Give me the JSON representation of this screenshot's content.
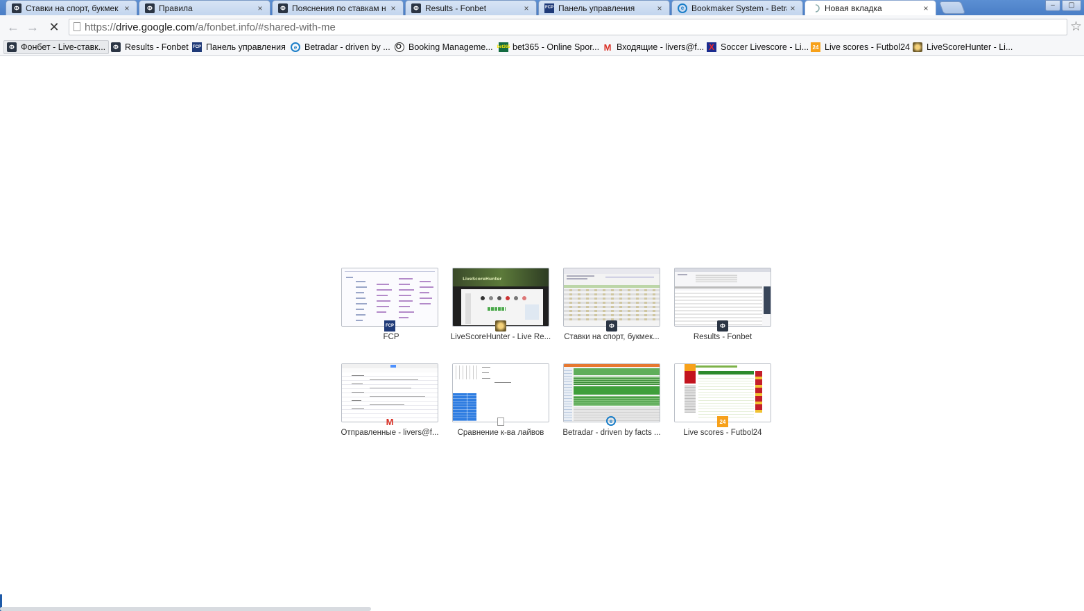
{
  "tabs": [
    {
      "title": "Ставки на спорт, букмек",
      "icon": "fonbet-icon",
      "active": false
    },
    {
      "title": "Правила",
      "icon": "fonbet-icon",
      "active": false
    },
    {
      "title": "Пояснения по ставкам н",
      "icon": "fonbet-icon",
      "active": false
    },
    {
      "title": "Results - Fonbet",
      "icon": "fonbet-icon",
      "active": false
    },
    {
      "title": "Панель управления",
      "icon": "fcp-icon",
      "active": false
    },
    {
      "title": "Bookmaker System - Betra",
      "icon": "betradar-icon",
      "active": false
    },
    {
      "title": "Новая вкладка",
      "icon": "loading-spinner-icon",
      "active": true
    }
  ],
  "tab_close_glyph": "×",
  "window_controls": {
    "minimize": "–",
    "maximize": "▢"
  },
  "toolbar": {
    "back_glyph": "←",
    "forward_glyph": "→",
    "stop_glyph": "✕",
    "url_scheme": "https://",
    "url_host": "drive.google.com",
    "url_path": "/a/fonbet.info/#shared-with-me",
    "star_glyph": "☆"
  },
  "bookmarks": [
    {
      "label": "Фонбет - Live-ставк...",
      "icon": "fonbet-icon"
    },
    {
      "label": "Results - Fonbet",
      "icon": "fonbet-icon"
    },
    {
      "label": "Панель управления",
      "icon": "fcp-icon"
    },
    {
      "label": "Betradar - driven by ...",
      "icon": "betradar-icon"
    },
    {
      "label": "Booking Manageme...",
      "icon": "soccer-ball-icon"
    },
    {
      "label": "bet365 - Online Spor...",
      "icon": "bet365-icon"
    },
    {
      "label": "Входящие - livers@f...",
      "icon": "gmail-icon"
    },
    {
      "label": "Soccer Livescore - Li...",
      "icon": "soccer-livescore-icon"
    },
    {
      "label": "Live scores - Futbol24",
      "icon": "futbol24-icon"
    },
    {
      "label": "LiveScoreHunter - Li...",
      "icon": "livescorehunter-icon"
    }
  ],
  "most_visited": [
    {
      "label": "FCP",
      "icon": "fcp-icon"
    },
    {
      "label": "LiveScoreHunter - Live Re...",
      "icon": "livescorehunter-icon"
    },
    {
      "label": "Ставки на спорт, букмек...",
      "icon": "fonbet-icon"
    },
    {
      "label": "Results - Fonbet",
      "icon": "fonbet-icon"
    },
    {
      "label": "Отправленные - livers@f...",
      "icon": "gmail-icon"
    },
    {
      "label": "Сравнение к-ва лайвов",
      "icon": "document-icon"
    },
    {
      "label": "Betradar - driven by facts ...",
      "icon": "betradar-icon"
    },
    {
      "label": "Live scores - Futbol24",
      "icon": "futbol24-icon"
    }
  ],
  "icon_text": {
    "fcp": "FCP",
    "betradar": "e",
    "bet365": "bet365",
    "gmail": "M",
    "soccer": "X",
    "futbol24": "24",
    "fonbet": "Ф"
  },
  "thumb_text": {
    "livescorehunter_banner": "LiveScoreHunter"
  }
}
